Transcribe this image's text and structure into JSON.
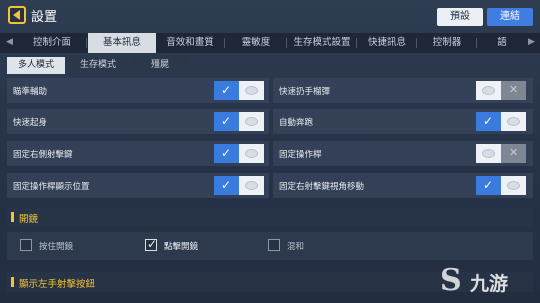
{
  "header": {
    "title": "設置",
    "preset_label": "預設",
    "link_label": "連結"
  },
  "tabs": [
    {
      "label": "控制介面"
    },
    {
      "label": "基本訊息"
    },
    {
      "label": "音效和畫質"
    },
    {
      "label": "靈敏度"
    },
    {
      "label": "生存模式設置"
    },
    {
      "label": "快捷訊息"
    },
    {
      "label": "控制器"
    },
    {
      "label": "語"
    }
  ],
  "subtabs": [
    {
      "label": "多人模式"
    },
    {
      "label": "生存模式"
    },
    {
      "label": "殭屍"
    }
  ],
  "settings": [
    {
      "label": "瞄準輔助",
      "on": true
    },
    {
      "label": "快速扔手榴彈",
      "on": false
    },
    {
      "label": "快速起身",
      "on": true
    },
    {
      "label": "自動奔跑",
      "on": true
    },
    {
      "label": "固定右側射擊鍵",
      "on": true
    },
    {
      "label": "固定操作桿",
      "on": false
    },
    {
      "label": "固定操作桿顯示位置",
      "on": true
    },
    {
      "label": "固定右射擊鍵視角移動",
      "on": true
    }
  ],
  "scope": {
    "title": "開鏡",
    "options": [
      {
        "label": "按住開鏡",
        "checked": false
      },
      {
        "label": "點擊開鏡",
        "checked": true
      },
      {
        "label": "混和",
        "checked": false
      }
    ]
  },
  "left_fire": {
    "title": "顯示左手射擊按鈕"
  },
  "watermark": {
    "symbol": "S",
    "text": "九游"
  },
  "colors": {
    "accent": "#3a7be0",
    "section": "#f3c335",
    "link_button": "#3f7ee0"
  }
}
